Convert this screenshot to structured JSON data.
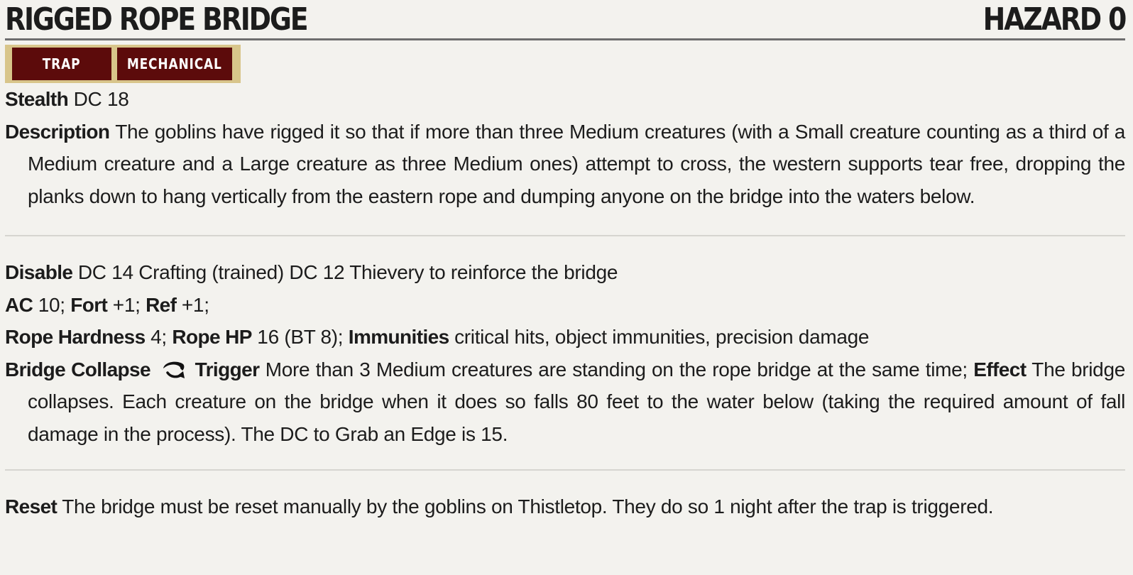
{
  "header": {
    "title": "RIGGED ROPE BRIDGE",
    "level": "HAZARD 0"
  },
  "traits": [
    "TRAP",
    "MECHANICAL"
  ],
  "stealth": {
    "label": "Stealth",
    "value": "DC 18"
  },
  "description": {
    "label": "Description",
    "text": "The goblins have rigged it so that if more than three Medium creatures (with a Small creature counting as a third of a Medium creature and a Large creature as three Medium ones) attempt to cross, the western supports tear free, dropping the planks down to hang vertically from the eastern rope and dumping anyone on the bridge into the waters below."
  },
  "disable": {
    "label": "Disable",
    "text": "DC 14 Crafting (trained) DC 12 Thievery to reinforce the bridge"
  },
  "defenses": {
    "ac_label": "AC",
    "ac_value": "10;",
    "fort_label": "Fort",
    "fort_value": "+1;",
    "ref_label": "Ref",
    "ref_value": "+1;"
  },
  "rope": {
    "hardness_label": "Rope Hardness",
    "hardness_value": "4;",
    "hp_label": "Rope HP",
    "hp_value": "16 (BT 8);",
    "immunities_label": "Immunities",
    "immunities_value": "critical hits, object immunities, precision damage"
  },
  "bridge_collapse": {
    "name": "Bridge Collapse",
    "icon": "reaction-icon",
    "trigger_label": "Trigger",
    "trigger_text": "More than 3 Medium creatures are standing on the rope bridge at the same time;",
    "effect_label": "Effect",
    "effect_text": "The bridge collapses. Each creature on the bridge when it does so falls 80 feet to the water below (taking the required amount of fall damage in the process). The DC to Grab an Edge is 15."
  },
  "reset": {
    "label": "Reset",
    "text": "The bridge must be reset manually by the goblins on Thistletop. They do so 1 night after the trap is triggered."
  }
}
